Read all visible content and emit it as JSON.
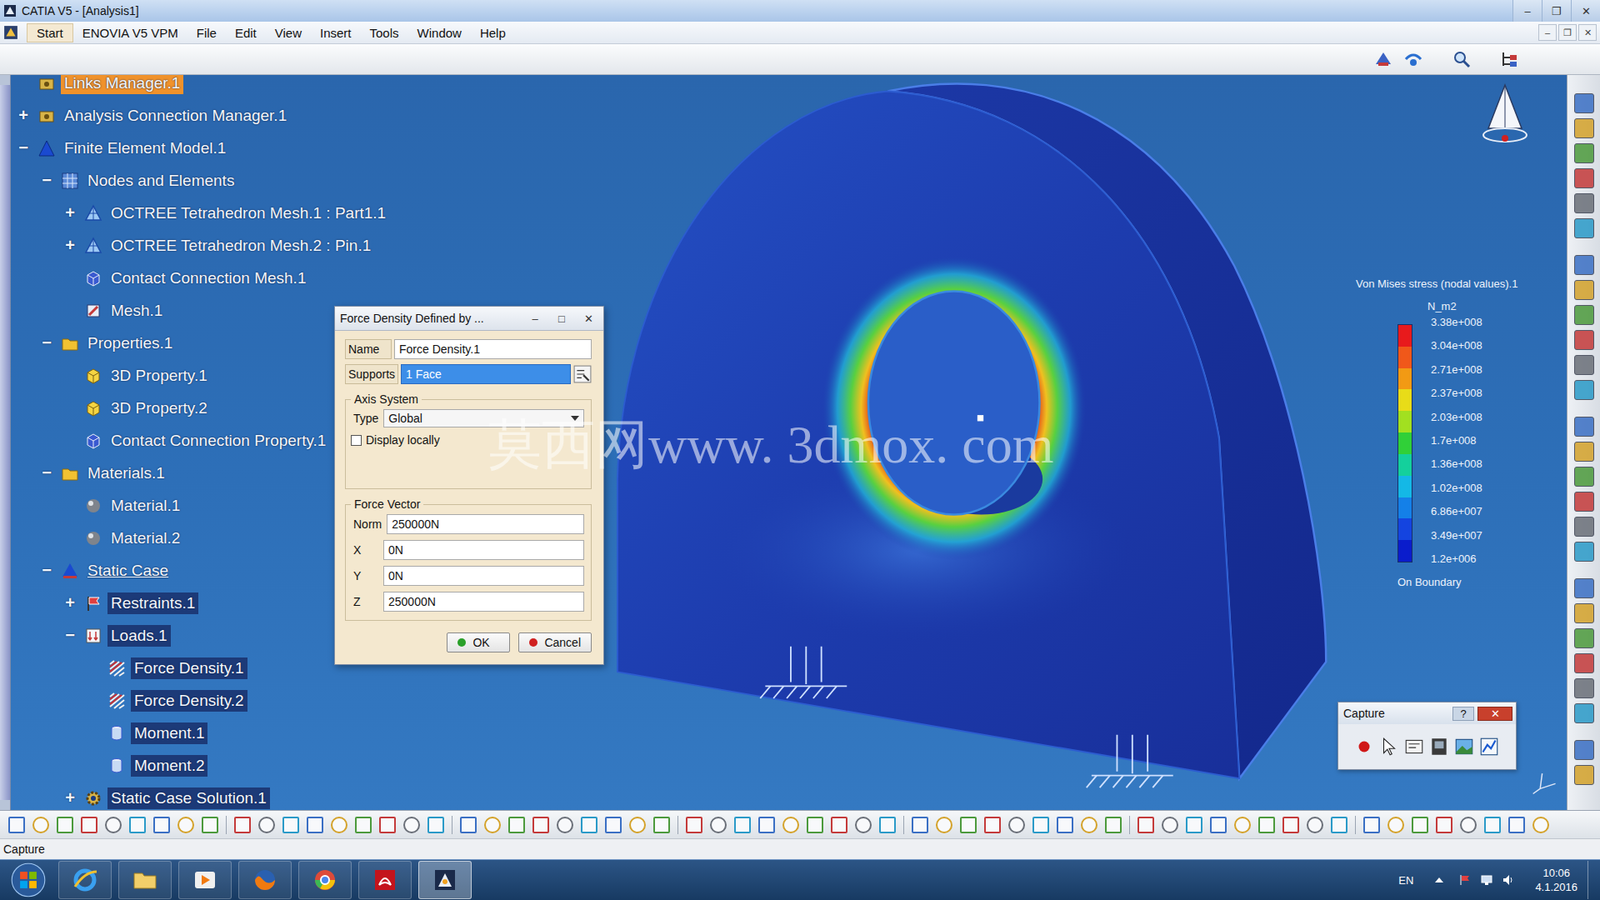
{
  "window": {
    "title": "CATIA V5 - [Analysis1]",
    "controls": [
      "–",
      "❐",
      "✕"
    ]
  },
  "menu": [
    "Start",
    "ENOVIA V5 VPM",
    "File",
    "Edit",
    "View",
    "Insert",
    "Tools",
    "Window",
    "Help"
  ],
  "mdi_controls": [
    "–",
    "❐",
    "✕"
  ],
  "tree": [
    {
      "label": "Links Manager.1",
      "level": 0,
      "expander": "",
      "kind": "manager",
      "selected": false,
      "highlighted": true,
      "active": false
    },
    {
      "label": "Analysis Connection Manager.1",
      "level": 0,
      "expander": "+",
      "kind": "manager",
      "selected": false,
      "highlighted": false,
      "active": false
    },
    {
      "label": "Finite Element Model.1",
      "level": 0,
      "expander": "−",
      "kind": "model",
      "selected": false,
      "highlighted": false,
      "active": false
    },
    {
      "label": "Nodes and Elements",
      "level": 1,
      "expander": "−",
      "kind": "nodes",
      "selected": false,
      "highlighted": false,
      "active": false
    },
    {
      "label": "OCTREE Tetrahedron Mesh.1 : Part1.1",
      "level": 2,
      "expander": "+",
      "kind": "mesh",
      "selected": false,
      "highlighted": false,
      "active": false
    },
    {
      "label": "OCTREE Tetrahedron Mesh.2 : Pin.1",
      "level": 2,
      "expander": "+",
      "kind": "mesh",
      "selected": false,
      "highlighted": false,
      "active": false
    },
    {
      "label": "Contact Connection Mesh.1",
      "level": 2,
      "expander": "",
      "kind": "connection",
      "selected": false,
      "highlighted": false,
      "active": false
    },
    {
      "label": "Mesh.1",
      "level": 2,
      "expander": "",
      "kind": "meshpart",
      "selected": false,
      "highlighted": false,
      "active": false
    },
    {
      "label": "Properties.1",
      "level": 1,
      "expander": "−",
      "kind": "folder",
      "selected": false,
      "highlighted": false,
      "active": false
    },
    {
      "label": "3D Property.1",
      "level": 2,
      "expander": "",
      "kind": "property",
      "selected": false,
      "highlighted": false,
      "active": false
    },
    {
      "label": "3D Property.2",
      "level": 2,
      "expander": "",
      "kind": "property",
      "selected": false,
      "highlighted": false,
      "active": false
    },
    {
      "label": "Contact Connection Property.1",
      "level": 2,
      "expander": "",
      "kind": "connection",
      "selected": false,
      "highlighted": false,
      "active": false
    },
    {
      "label": "Materials.1",
      "level": 1,
      "expander": "−",
      "kind": "folder",
      "selected": false,
      "highlighted": false,
      "active": false
    },
    {
      "label": "Material.1",
      "level": 2,
      "expander": "",
      "kind": "material",
      "selected": false,
      "highlighted": false,
      "active": false
    },
    {
      "label": "Material.2",
      "level": 2,
      "expander": "",
      "kind": "material",
      "selected": false,
      "highlighted": false,
      "active": false
    },
    {
      "label": "Static Case",
      "level": 1,
      "expander": "−",
      "kind": "case",
      "selected": false,
      "highlighted": false,
      "active": true
    },
    {
      "label": "Restraints.1",
      "level": 2,
      "expander": "+",
      "kind": "restraint",
      "selected": true,
      "highlighted": false,
      "active": false
    },
    {
      "label": "Loads.1",
      "level": 2,
      "expander": "−",
      "kind": "load",
      "selected": true,
      "highlighted": false,
      "active": false
    },
    {
      "label": "Force Density.1",
      "level": 3,
      "expander": "",
      "kind": "force",
      "selected": true,
      "highlighted": false,
      "active": false
    },
    {
      "label": "Force Density.2",
      "level": 3,
      "expander": "",
      "kind": "force",
      "selected": true,
      "highlighted": false,
      "active": false
    },
    {
      "label": "Moment.1",
      "level": 3,
      "expander": "",
      "kind": "moment",
      "selected": true,
      "highlighted": false,
      "active": false
    },
    {
      "label": "Moment.2",
      "level": 3,
      "expander": "",
      "kind": "moment",
      "selected": true,
      "highlighted": false,
      "active": false
    },
    {
      "label": "Static Case Solution.1",
      "level": 2,
      "expander": "+",
      "kind": "solution",
      "selected": true,
      "highlighted": false,
      "active": false
    }
  ],
  "legend": {
    "title": "Von Mises stress (nodal values).1",
    "unit": "N_m2",
    "footer": "On Boundary",
    "values": [
      {
        "label": "3.38e+008",
        "color": "#e81a1c"
      },
      {
        "label": "3.04e+008",
        "color": "#f0581a"
      },
      {
        "label": "2.71e+008",
        "color": "#f29a14"
      },
      {
        "label": "2.37e+008",
        "color": "#e8dc18"
      },
      {
        "label": "2.03e+008",
        "color": "#a2e020"
      },
      {
        "label": "1.7e+008",
        "color": "#30d038"
      },
      {
        "label": "1.36e+008",
        "color": "#14d09c"
      },
      {
        "label": "1.02e+008",
        "color": "#14b8e6"
      },
      {
        "label": "6.86e+007",
        "color": "#1480e8"
      },
      {
        "label": "3.49e+007",
        "color": "#1444e0"
      },
      {
        "label": "1.2e+006",
        "color": "#0a1ccc"
      }
    ]
  },
  "dialog": {
    "title": "Force Density Defined by ...",
    "controls": [
      "–",
      "□",
      "✕"
    ],
    "name": {
      "label": "Name",
      "value": "Force Density.1"
    },
    "supports": {
      "label": "Supports",
      "value": "1 Face",
      "selected": true
    },
    "axis_group": "Axis System",
    "type": {
      "label": "Type",
      "value": "Global"
    },
    "display_locally": {
      "label": "Display locally",
      "checked": false
    },
    "force_group": "Force Vector",
    "components": [
      {
        "label": "Norm",
        "value": "250000N"
      },
      {
        "label": "X",
        "value": "0N"
      },
      {
        "label": "Y",
        "value": "0N"
      },
      {
        "label": "Z",
        "value": "250000N"
      }
    ],
    "buttons": [
      {
        "label": "OK",
        "kind": "ok"
      },
      {
        "label": "Cancel",
        "kind": "cancel"
      }
    ]
  },
  "capture": {
    "title": "Capture",
    "help": "?",
    "close": "✕"
  },
  "watermark": "莫西网www. 3dmox. com",
  "status_bar": "Capture",
  "taskbar": {
    "language": "EN",
    "time": "10:06",
    "date": "4.1.2016"
  }
}
